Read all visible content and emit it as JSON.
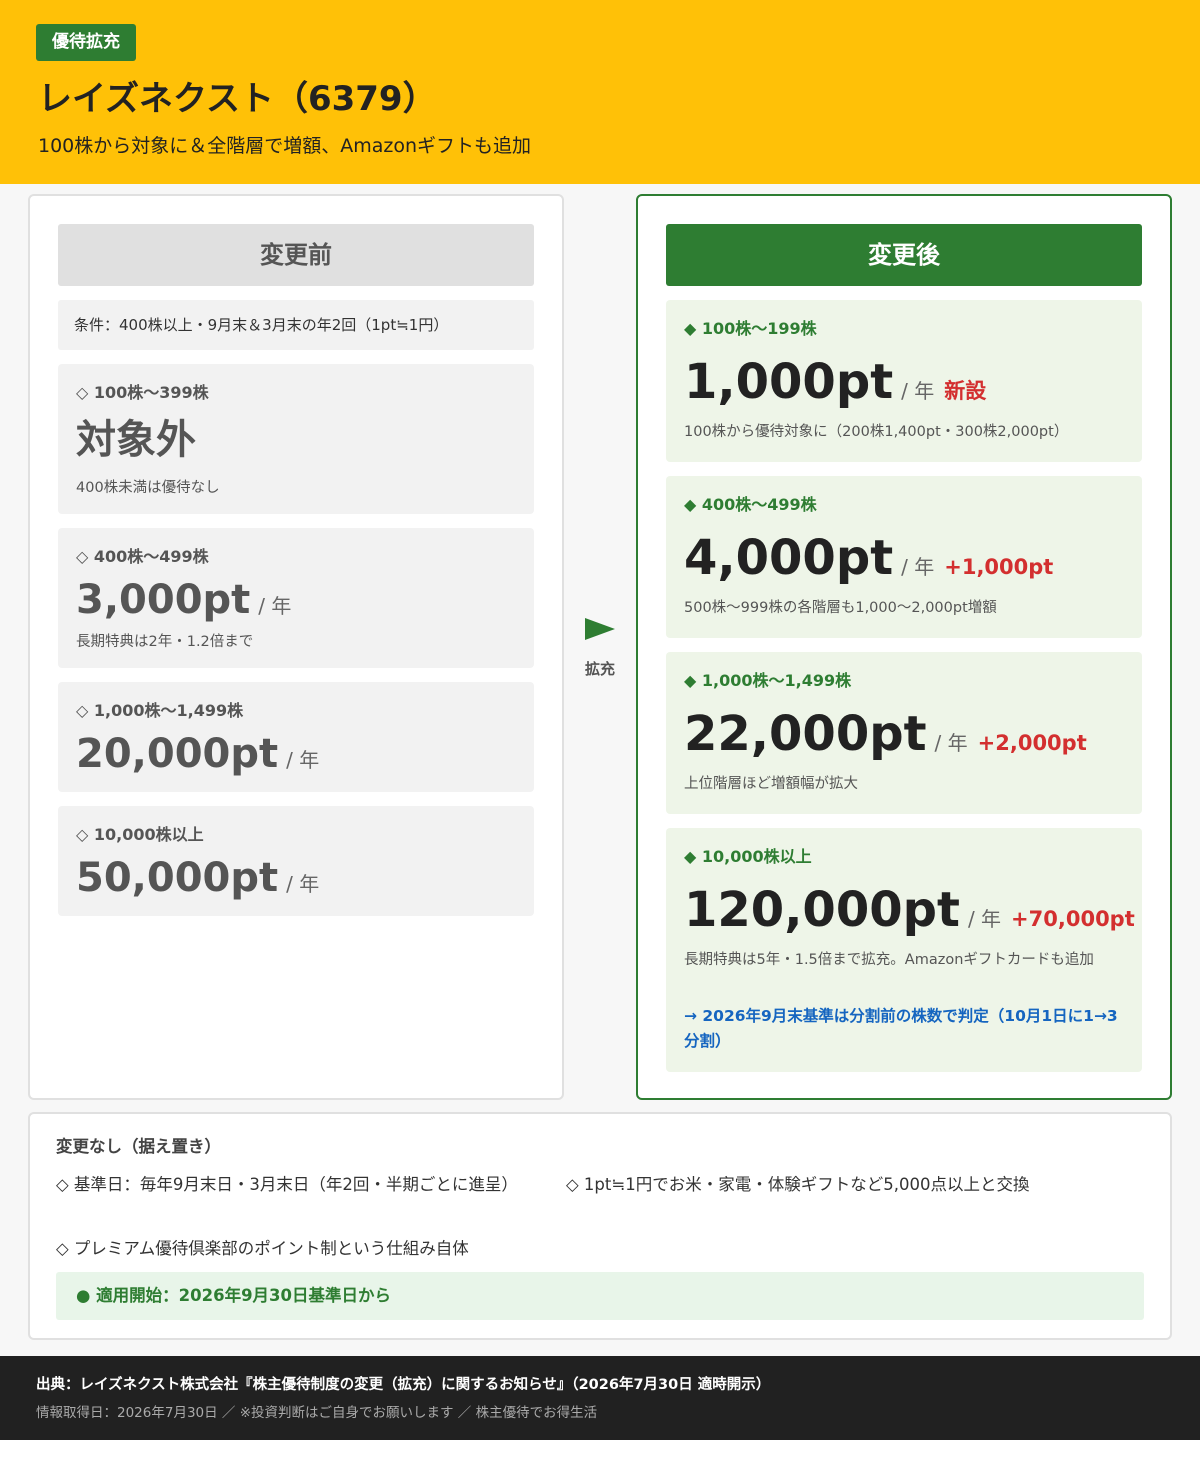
{
  "header": {
    "badge": "優待拡充",
    "title": "レイズネクスト（6379）",
    "subtitle": "100株から対象に＆全階層で増額、Amazonギフトも追加"
  },
  "before": {
    "heading": "変更前",
    "condition": "条件：400株以上・9月末＆3月末の年2回（1pt≒1円）",
    "tiers": [
      {
        "label": "◇ 100株〜399株",
        "value": "対象外",
        "unit": "",
        "note": "400株未満は優待なし"
      },
      {
        "label": "◇ 400株〜499株",
        "value": "3,000pt",
        "unit": "/ 年",
        "note": "長期特典は2年・1.2倍まで"
      },
      {
        "label": "◇ 1,000株〜1,499株",
        "value": "20,000pt",
        "unit": "/ 年",
        "note": ""
      },
      {
        "label": "◇ 10,000株以上",
        "value": "50,000pt",
        "unit": "/ 年",
        "note": ""
      }
    ]
  },
  "arrow": {
    "label": "拡充"
  },
  "after": {
    "heading": "変更後",
    "tiers": [
      {
        "label": "◆ 100株〜199株",
        "value": "1,000pt",
        "unit": "/ 年",
        "delta": "新設",
        "note": "100株から優待対象に（200株1,400pt・300株2,000pt）",
        "link": ""
      },
      {
        "label": "◆ 400株〜499株",
        "value": "4,000pt",
        "unit": "/ 年",
        "delta": "+1,000pt",
        "note": "500株〜999株の各階層も1,000〜2,000pt増額",
        "link": ""
      },
      {
        "label": "◆ 1,000株〜1,499株",
        "value": "22,000pt",
        "unit": "/ 年",
        "delta": "+2,000pt",
        "note": "上位階層ほど増額幅が拡大",
        "link": ""
      },
      {
        "label": "◆ 10,000株以上",
        "value": "120,000pt",
        "unit": "/ 年",
        "delta": "+70,000pt",
        "note": "長期特典は5年・1.5倍まで拡充。Amazonギフトカードも追加",
        "link": "→ 2026年9月末基準は分割前の株数で判定（10月1日に1→3分割）"
      }
    ]
  },
  "unchanged": {
    "title": "変更なし（据え置き）",
    "items": [
      "◇ 基準日：毎年9月末日・3月末日（年2回・半期ごとに進呈）",
      "◇ 1pt≒1円でお米・家電・体験ギフトなど5,000点以上と交換",
      "◇ プレミアム優待倶楽部のポイント制という仕組み自体"
    ],
    "apply": "● 適用開始：2026年9月30日基準日から"
  },
  "footer": {
    "source": "出典：レイズネクスト株式会社『株主優待制度の変更（拡充）に関するお知らせ』（2026年7月30日 適時開示）",
    "meta": "情報取得日：2026年7月30日 ／ ※投資判断はご自身でお願いします ／ 株主優待でお得生活"
  },
  "colors": {
    "header_bg": "#ffc107",
    "accent_green": "#2e7d32",
    "delta_red": "#d32f2f",
    "link_blue": "#1565c0",
    "footer_bg": "#212121"
  }
}
